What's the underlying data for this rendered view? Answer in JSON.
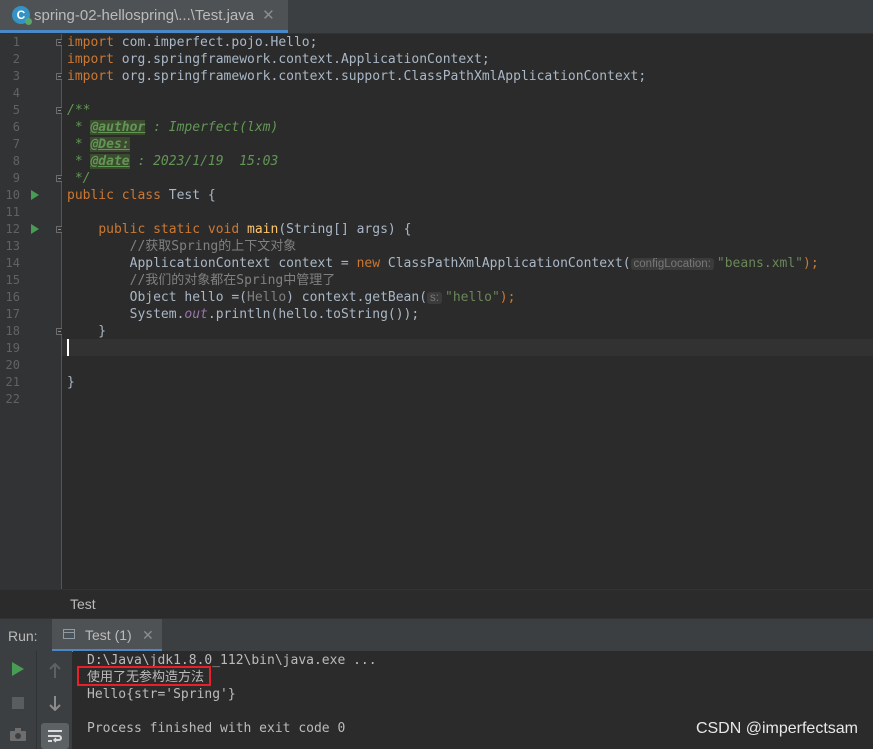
{
  "tab": {
    "title": "spring-02-hellospring\\...\\Test.java",
    "close": "✕",
    "icon_letter": "C"
  },
  "editor": {
    "line_numbers": [
      "1",
      "2",
      "3",
      "4",
      "5",
      "6",
      "7",
      "8",
      "9",
      "10",
      "11",
      "12",
      "13",
      "14",
      "15",
      "16",
      "17",
      "18",
      "19",
      "20",
      "21",
      "22"
    ],
    "code": {
      "l1_kw": "import",
      "l1_rest": " com.imperfect.pojo.Hello;",
      "l2_kw": "import",
      "l2_rest": " org.springframework.context.ApplicationContext;",
      "l3_kw": "import",
      "l3_rest": " org.springframework.context.support.ClassPathXmlApplicationContext;",
      "l5": "/**",
      "l6_pre": " * ",
      "l6_tag": "@author",
      "l6_rest": " : Imperfect(lxm)",
      "l7_pre": " * ",
      "l7_tag": "@Des:",
      "l8_pre": " * ",
      "l8_tag": "@date",
      "l8_rest": " : 2023/1/19  15:03",
      "l9": " */",
      "l10_kw": "public class",
      "l10_rest": " Test {",
      "l12_indent": "    ",
      "l12_kw": "public static void",
      "l12_sp": " ",
      "l12_fn": "main",
      "l12_rest": "(String[] args) {",
      "l13": "        //获取Spring的上下文对象",
      "l14_a": "        ApplicationContext context = ",
      "l14_kw": "new",
      "l14_b": " ClassPathXmlApplicationContext(",
      "l14_hint": "configLocation:",
      "l14_str": "\"beans.xml\"",
      "l14_end": ");",
      "l15": "        //我们的对象都在Spring中管理了",
      "l16_a": "        Object hello =(",
      "l16_cast": "Hello",
      "l16_b": ") context.getBean(",
      "l16_hint": "s:",
      "l16_str": "\"hello\"",
      "l16_end": ");",
      "l17_a": "        System.",
      "l17_out": "out",
      "l17_b": ".println(hello.toString());",
      "l18": "    }",
      "l21": "}"
    }
  },
  "breadcrumb": "Test",
  "run_panel": {
    "label": "Run:",
    "tab_label": "Test (1)",
    "tab_close": "✕",
    "output": [
      "D:\\Java\\jdk1.8.0_112\\bin\\java.exe ...",
      "使用了无参构造方法",
      "Hello{str='Spring'}",
      "",
      "Process finished with exit code 0"
    ]
  },
  "watermark": "CSDN @imperfectsam",
  "colors": {
    "accent": "#4a88c7",
    "run_green": "#499c54",
    "highlight_box": "#e8202a"
  }
}
